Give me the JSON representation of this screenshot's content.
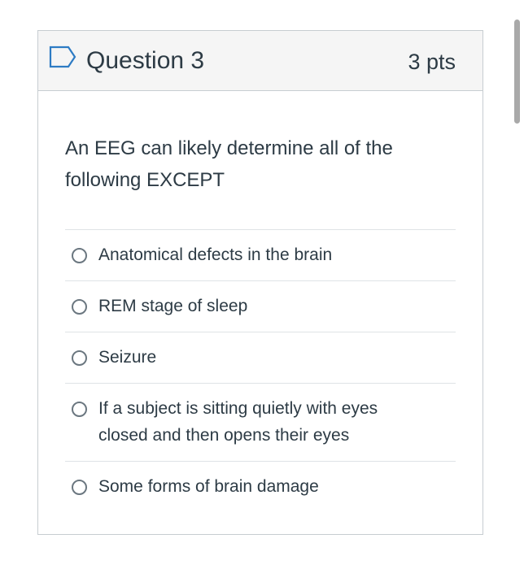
{
  "question": {
    "title": "Question 3",
    "points": "3 pts",
    "text": "An EEG can likely determine all of the following EXCEPT",
    "answers": [
      {
        "label": "Anatomical defects in the brain"
      },
      {
        "label": "REM stage of sleep"
      },
      {
        "label": "Seizure"
      },
      {
        "label": "If a subject is sitting quietly with eyes closed and then opens their eyes"
      },
      {
        "label": "Some forms of brain damage"
      }
    ]
  },
  "colors": {
    "accent": "#2d7bc4",
    "header_bg": "#f5f5f5",
    "border": "#c7cdd1",
    "text": "#2d3b45"
  },
  "icons": {
    "flag": "bookmark-flag-icon",
    "radio": "radio-button-icon"
  }
}
